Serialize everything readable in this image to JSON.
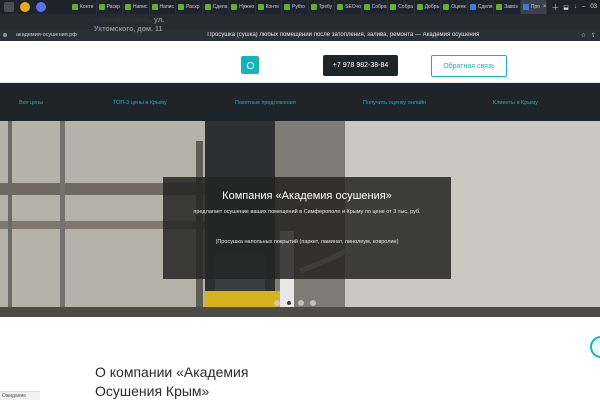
{
  "browser": {
    "tabs": [
      {
        "label": "Конте",
        "favicon": "leaf-favicon"
      },
      {
        "label": "Раскр",
        "favicon": "leaf-favicon"
      },
      {
        "label": "Напис",
        "favicon": "leaf-favicon"
      },
      {
        "label": "Напис",
        "favicon": "leaf-favicon"
      },
      {
        "label": "Раскр",
        "favicon": "leaf-favicon"
      },
      {
        "label": "Сдела",
        "favicon": "leaf-favicon"
      },
      {
        "label": "Нужно",
        "favicon": "leaf-favicon"
      },
      {
        "label": "Конте",
        "favicon": "leaf-favicon"
      },
      {
        "label": "Pytho",
        "favicon": "leaf-favicon"
      },
      {
        "label": "Требу",
        "favicon": "leaf-favicon"
      },
      {
        "label": "SEO-ко",
        "favicon": "leaf-favicon"
      },
      {
        "label": "Собра",
        "favicon": "leaf-favicon"
      },
      {
        "label": "Собра",
        "favicon": "leaf-favicon"
      },
      {
        "label": "Добрь",
        "favicon": "leaf-favicon"
      },
      {
        "label": "Оценк",
        "favicon": "leaf-favicon"
      },
      {
        "label": "Сделя",
        "favicon": "globe-favicon"
      },
      {
        "label": "Завоз",
        "favicon": "leaf-favicon"
      },
      {
        "label": "Про",
        "favicon": "globe-favicon",
        "active": true
      }
    ],
    "clock": "03",
    "url": "академия-осушения.рф",
    "page_title": "Просушка (сушка) любых помещений после затопления, залива, ремонта — Академия осушения"
  },
  "header": {
    "address_city": "г. Симферополь,",
    "address_street": "ул. Ухтомского, дом. 11",
    "phone": "+7 978 982-38-84",
    "callback": "Обратная связь"
  },
  "nav": {
    "items": [
      "Все цены",
      "ТОП-3 цены в Крыму",
      "Пакетные предложения",
      "Получить оценку онлайн",
      "Клиенты в Крыму"
    ]
  },
  "hero": {
    "heading": "Компания «Академия осушения»",
    "subtext": "предлагает осушение ваших помещений в Симферополе и Крыму по цене от 3 тыс. руб.",
    "note": "(Просушка напольных покрытий (паркет, ламинат, линолеум, ковролин)",
    "slides": 4,
    "active_slide": 1
  },
  "about": {
    "title_line1": "О компании «Академия",
    "title_line2": "Осушения Крым»"
  },
  "status": {
    "text": "Ожидание"
  },
  "colors": {
    "accent": "#18b3ba",
    "dark": "#1f2429"
  }
}
